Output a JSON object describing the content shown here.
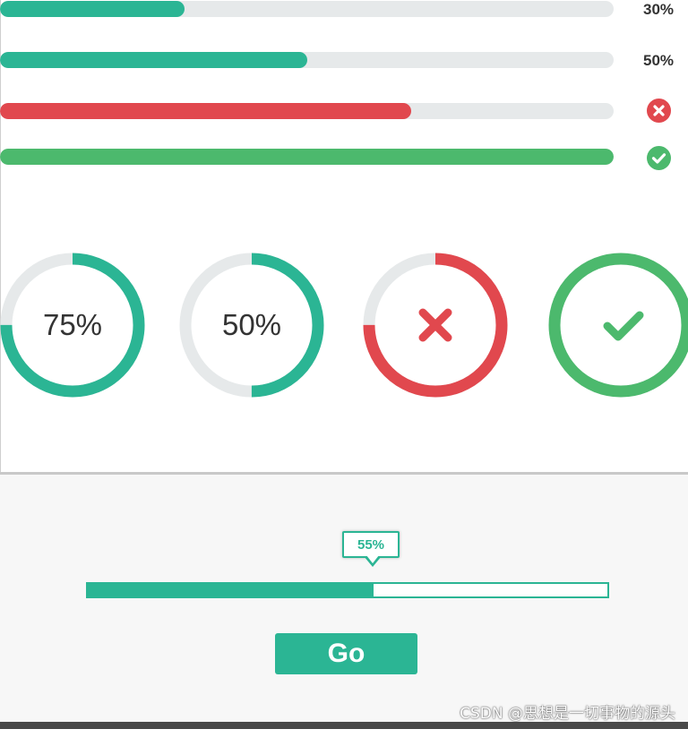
{
  "colors": {
    "teal": "#2bb594",
    "red": "#e1484e",
    "green": "#4cb96d",
    "track": "#e6e9ea"
  },
  "linear_bars": [
    {
      "progress": 0.3,
      "color": "#2bb594",
      "label": "30%"
    },
    {
      "progress": 0.5,
      "color": "#2bb594",
      "label": "50%"
    },
    {
      "progress": 0.67,
      "color": "#e1484e",
      "status_icon": "error-x-icon"
    },
    {
      "progress": 1.0,
      "color": "#4cb96d",
      "status_icon": "success-check-icon"
    }
  ],
  "circles": [
    {
      "progress": 0.75,
      "color": "#2bb594",
      "label": "75%"
    },
    {
      "progress": 0.5,
      "color": "#2bb594",
      "label": "50%"
    },
    {
      "progress": 0.75,
      "color": "#e1484e",
      "status_icon": "error-x-icon"
    },
    {
      "progress": 1.0,
      "color": "#4cb96d",
      "status_icon": "success-check-icon"
    }
  ],
  "slider": {
    "progress": 0.55,
    "tooltip": "55%"
  },
  "go_button": {
    "label": "Go"
  },
  "watermark": "CSDN @思想是一切事物的源头"
}
